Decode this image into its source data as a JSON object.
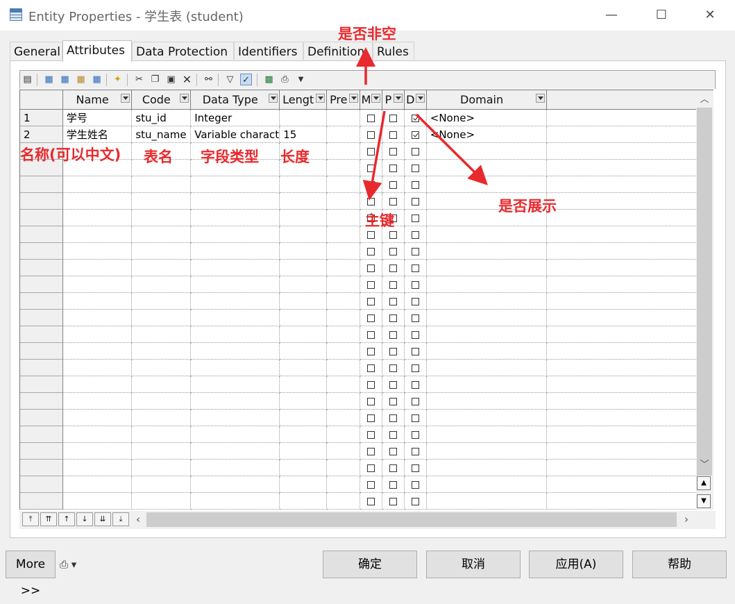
{
  "window": {
    "title": "Entity Properties - 学生表 (student)",
    "minimize_glyph": "—",
    "maximize_glyph": "☐",
    "close_glyph": "✕"
  },
  "tabs": [
    {
      "label": "General"
    },
    {
      "label": "Attributes",
      "active": true
    },
    {
      "label": "Data Protection"
    },
    {
      "label": "Identifiers"
    },
    {
      "label": "Definition"
    },
    {
      "label": "Rules"
    }
  ],
  "toolbar": {
    "icons": [
      "properties-icon",
      "add-row-icon",
      "insert-row-icon",
      "add-attributes-icon",
      "reuse-attributes-icon",
      "find-icon",
      "cut-icon",
      "copy-icon",
      "paste-icon",
      "delete-icon",
      "search-icon",
      "filter-icon",
      "customize-columns-icon",
      "excel-icon",
      "print-icon",
      "dropdown-arrow-icon"
    ]
  },
  "grid": {
    "columns": [
      "Name",
      "Code",
      "Data Type",
      "Lengt",
      "Pre",
      "M",
      "P",
      "D",
      "Domain"
    ],
    "rows": [
      {
        "num": "1",
        "name": "学号",
        "code": "stu_id",
        "type": "Integer",
        "length": "",
        "m": false,
        "p": false,
        "d": true,
        "domain": "<None>"
      },
      {
        "num": "2",
        "name": "学生姓名",
        "code": "stu_name",
        "type": "Variable charact",
        "length": "15",
        "m": false,
        "p": false,
        "d": true,
        "domain": "<None>"
      }
    ],
    "empty_rows": 23
  },
  "navigation": {
    "buttons": [
      "move-top",
      "move-up-page",
      "move-up",
      "move-down",
      "move-down-page",
      "move-bottom"
    ]
  },
  "bottom": {
    "more_label": "More >>",
    "ok_label": "确定",
    "cancel_label": "取消",
    "apply_label": "应用(A)",
    "help_label": "帮助"
  },
  "annotations": {
    "not_null": "是否非空",
    "name_note": "名称(可以中文)",
    "table_name": "表名",
    "field_type": "字段类型",
    "length": "长度",
    "primary_key": "主键",
    "displayed": "是否展示"
  },
  "colors": {
    "annotation": "#e8292d",
    "window_bg": "#f0f0f0"
  }
}
